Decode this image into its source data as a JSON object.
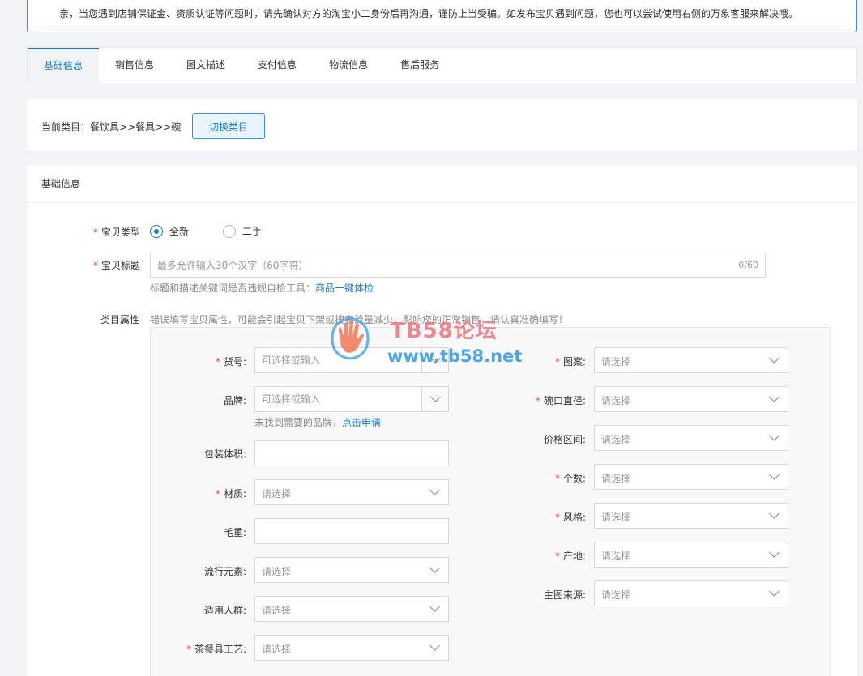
{
  "notice": "亲，当您遇到店铺保证金、资质认证等问题时，请先确认对方的淘宝小二身份后再沟通，谨防上当受骗。如发布宝贝遇到问题，您也可以尝试使用右侧的万象客服来解决哦。",
  "tabs": [
    {
      "label": "基础信息",
      "active": true
    },
    {
      "label": "销售信息"
    },
    {
      "label": "图文描述"
    },
    {
      "label": "支付信息"
    },
    {
      "label": "物流信息"
    },
    {
      "label": "售后服务"
    }
  ],
  "category": {
    "current_text": "当前类目：餐饮具>>餐具>>碗",
    "switch_label": "切换类目"
  },
  "section": {
    "title": "基础信息",
    "item_type": {
      "label": "宝贝类型",
      "options": [
        "全新",
        "二手"
      ],
      "selected": "全新"
    },
    "item_title": {
      "label": "宝贝标题",
      "placeholder": "最多允许输入30个汉字（60字符）",
      "counter": "0/60",
      "hint_prefix": "标题和描述关键词是否违规自检工具：",
      "hint_link": "商品一键体检"
    },
    "attributes": {
      "label": "类目属性",
      "warning": "错误填写宝贝属性，可能会引起宝贝下架或搜索流量减少，影响您的正常销售，请认真准确填写！",
      "left": [
        {
          "label": "货号:",
          "required": true,
          "placeholder": "可选择或输入"
        },
        {
          "label": "品牌:",
          "required": false,
          "placeholder": "可选择或输入"
        },
        {
          "label": "包装体积:",
          "required": false,
          "placeholder": ""
        },
        {
          "label": "材质:",
          "required": true,
          "placeholder": "请选择"
        },
        {
          "label": "毛重:",
          "required": false,
          "placeholder": ""
        },
        {
          "label": "流行元素:",
          "required": false,
          "placeholder": "请选择"
        },
        {
          "label": "适用人群:",
          "required": false,
          "placeholder": "请选择"
        },
        {
          "label": "茶餐具工艺:",
          "required": true,
          "placeholder": "请选择"
        }
      ],
      "brand_hint_prefix": "未找到需要的品牌，",
      "brand_hint_link": "点击申请",
      "right": [
        {
          "label": "图案:",
          "required": true,
          "placeholder": "请选择"
        },
        {
          "label": "碗口直径:",
          "required": true,
          "placeholder": "请选择"
        },
        {
          "label": "价格区间:",
          "required": false,
          "placeholder": "请选择"
        },
        {
          "label": "个数:",
          "required": true,
          "placeholder": "请选择"
        },
        {
          "label": "风格:",
          "required": true,
          "placeholder": "请选择"
        },
        {
          "label": "产地:",
          "required": true,
          "placeholder": "请选择"
        },
        {
          "label": "主图来源:",
          "required": false,
          "placeholder": "请选择"
        }
      ]
    }
  },
  "watermark": {
    "title": "TB58论坛",
    "url": "www.tb58.net"
  },
  "colors": {
    "accent": "#1a7cc7",
    "required": "#e84040"
  }
}
